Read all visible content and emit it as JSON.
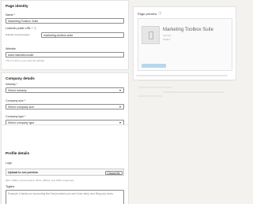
{
  "identity": {
    "title": "Page identity",
    "name_label": "Name *",
    "name_value": "Marketing Toolbox Suite",
    "url_label": "LinkedIn public URL *",
    "url_prefix": "linkedin.com/company/",
    "url_value": "marketing-toolbox-suite",
    "website_label": "Website",
    "website_value": "www.mktoolboxsuite",
    "website_help": "This is a link to your external website."
  },
  "company": {
    "title": "Company details",
    "industry_label": "Industry *",
    "industry_value": "Select industry",
    "size_label": "Company size *",
    "size_value": "Select company size",
    "type_label": "Company type *",
    "type_value": "Select company type"
  },
  "profile": {
    "title": "Profile details",
    "logo_label": "Logo",
    "upload_label": "Upload to see preview",
    "choose_label": "Choose file",
    "upload_help": "300 x 300px recommended. JPGs, JPEGs, and PNGs supported.",
    "tagline_label": "Tagline",
    "tagline_placeholder": "Example: A family-run accounting firm that promises you won't lose sleep over filing your taxes."
  },
  "preview": {
    "header": "Page preview",
    "company_name": "Marketing Toolbox Suite",
    "industry_placeholder": "Industry",
    "tagline_placeholder": "Tagline"
  }
}
